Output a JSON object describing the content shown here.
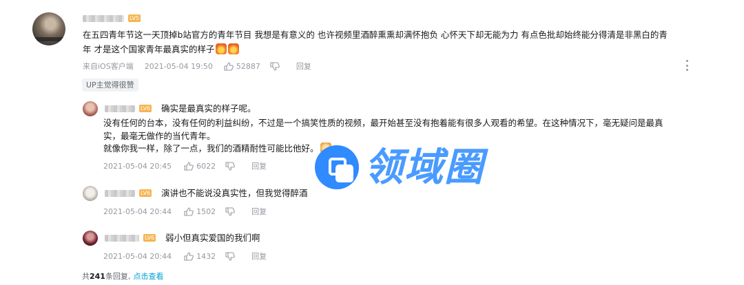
{
  "main_comment": {
    "level": "LV5",
    "lines": [
      "在五四青年节这一天顶掉b站官方的青年节目 我想是有意义的 也许视频里酒醉熏熏却满怀抱负 心怀天下却无能为力 有点色批却始终能分得清是非黑白的青",
      "年 才是这个国家青年最真实的样子"
    ],
    "emojis": [
      "fire-emoji",
      "fire-emoji"
    ],
    "source": "来自iOS客户端",
    "time": "2021-05-04 19:50",
    "likes": "52887",
    "reply_label": "回复",
    "up_tag": "UP主觉得很赞"
  },
  "replies": [
    {
      "level": "LV6",
      "lines": [
        "确实是最真实的样子呢。",
        "没有任何的台本，没有任何的利益纠纷，不过是一个搞笑性质的视频，最开始甚至没有抱着能有很多人观看的希望。在这种情况下，毫无疑问是最真",
        "实，最毫无做作的当代青年。",
        "就像你我一样，除了一点，我们的酒精耐性可能比他好。"
      ],
      "time": "2021-05-04 20:45",
      "likes": "6022",
      "reply_label": "回复"
    },
    {
      "level": "LV6",
      "lines": [
        "演讲也不能说没真实性，但我觉得醉酒"
      ],
      "time": "2021-05-04 20:44",
      "likes": "1502",
      "reply_label": "回复"
    },
    {
      "level": "LV6",
      "lines": [
        "弱小但真实爱国的我们啊"
      ],
      "time": "2021-05-04 20:44",
      "likes": "1432",
      "reply_label": "回复"
    }
  ],
  "footer": {
    "prefix": "共",
    "count": "241",
    "suffix": "条回复,",
    "link": "点击查看"
  },
  "watermark": {
    "text": "领域圈",
    "color": "#2f8bff"
  },
  "colors": {
    "meta_gray": "#9499a0",
    "level_badge": "#f6b451",
    "link_blue": "#00a1d6"
  }
}
